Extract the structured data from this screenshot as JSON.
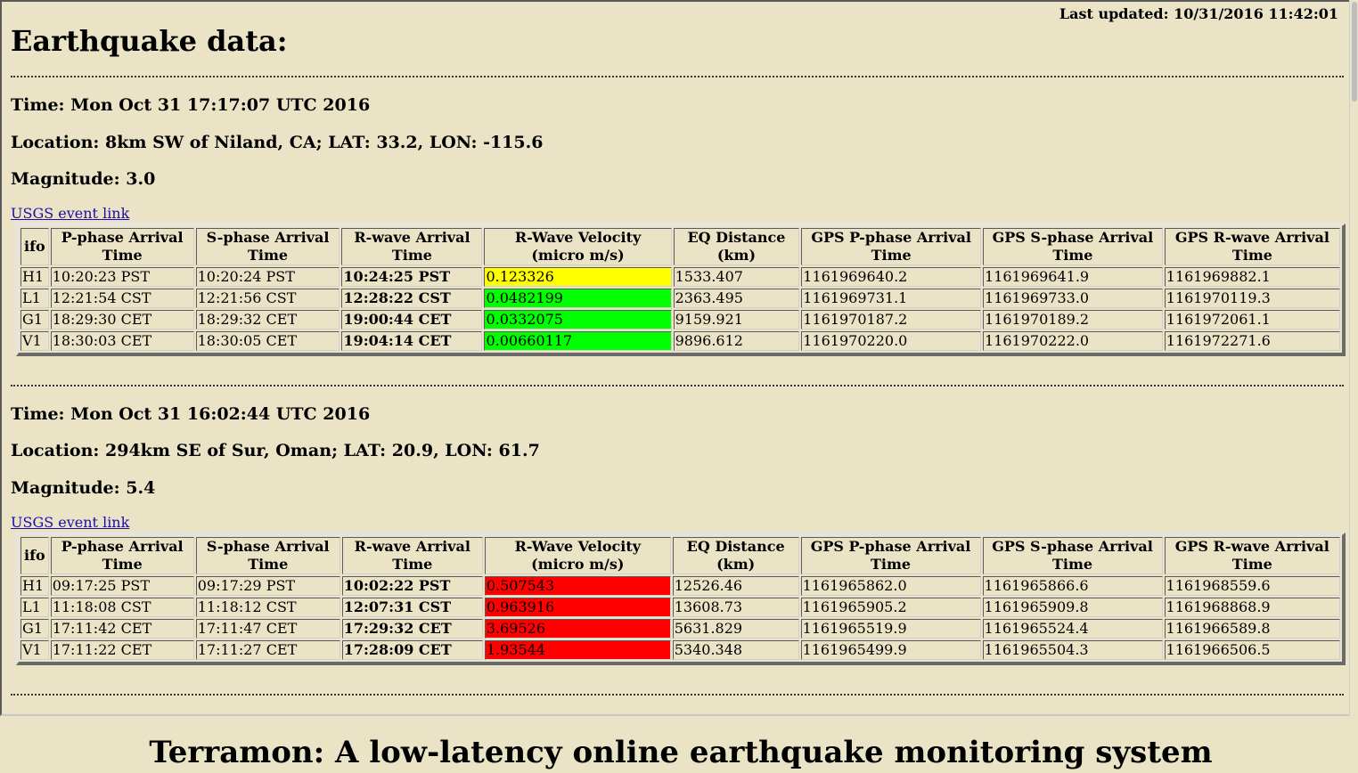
{
  "last_updated": "Last updated: 10/31/2016 11:42:01",
  "page_title": "Earthquake data:",
  "footer_title": "Terramon: A low-latency online earthquake monitoring system",
  "columns": [
    "ifo",
    "P-phase Arrival Time",
    "S-phase Arrival Time",
    "R-wave Arrival Time",
    "R-Wave Velocity (micro m/s)",
    "EQ Distance (km)",
    "GPS P-phase Arrival Time",
    "GPS S-phase Arrival Time",
    "GPS R-wave Arrival Time"
  ],
  "velocity_colors": {
    "yellow": "#ffff00",
    "green": "#00ff00",
    "red": "#ff0000"
  },
  "events": [
    {
      "time": "Time: Mon Oct 31 17:17:07 UTC 2016",
      "location": "Location: 8km SW of Niland, CA; LAT: 33.2, LON: -115.6",
      "magnitude": "Magnitude: 3.0",
      "link": "USGS event link",
      "rows": [
        {
          "ifo": "H1",
          "p": "10:20:23 PST",
          "s": "10:20:24 PST",
          "r": "10:24:25 PST",
          "v": "0.123326",
          "vcolor": "yellow",
          "dist": "1533.407",
          "gp": "1161969640.2",
          "gs": "1161969641.9",
          "gr": "1161969882.1"
        },
        {
          "ifo": "L1",
          "p": "12:21:54 CST",
          "s": "12:21:56 CST",
          "r": "12:28:22 CST",
          "v": "0.0482199",
          "vcolor": "green",
          "dist": "2363.495",
          "gp": "1161969731.1",
          "gs": "1161969733.0",
          "gr": "1161970119.3"
        },
        {
          "ifo": "G1",
          "p": "18:29:30 CET",
          "s": "18:29:32 CET",
          "r": "19:00:44 CET",
          "v": "0.0332075",
          "vcolor": "green",
          "dist": "9159.921",
          "gp": "1161970187.2",
          "gs": "1161970189.2",
          "gr": "1161972061.1"
        },
        {
          "ifo": "V1",
          "p": "18:30:03 CET",
          "s": "18:30:05 CET",
          "r": "19:04:14 CET",
          "v": "0.00660117",
          "vcolor": "green",
          "dist": "9896.612",
          "gp": "1161970220.0",
          "gs": "1161970222.0",
          "gr": "1161972271.6"
        }
      ]
    },
    {
      "time": "Time: Mon Oct 31 16:02:44 UTC 2016",
      "location": "Location: 294km SE of Sur, Oman; LAT: 20.9, LON: 61.7",
      "magnitude": "Magnitude: 5.4",
      "link": "USGS event link",
      "rows": [
        {
          "ifo": "H1",
          "p": "09:17:25 PST",
          "s": "09:17:29 PST",
          "r": "10:02:22 PST",
          "v": "0.507543",
          "vcolor": "red",
          "dist": "12526.46",
          "gp": "1161965862.0",
          "gs": "1161965866.6",
          "gr": "1161968559.6"
        },
        {
          "ifo": "L1",
          "p": "11:18:08 CST",
          "s": "11:18:12 CST",
          "r": "12:07:31 CST",
          "v": "0.963916",
          "vcolor": "red",
          "dist": "13608.73",
          "gp": "1161965905.2",
          "gs": "1161965909.8",
          "gr": "1161968868.9"
        },
        {
          "ifo": "G1",
          "p": "17:11:42 CET",
          "s": "17:11:47 CET",
          "r": "17:29:32 CET",
          "v": "3.69526",
          "vcolor": "red",
          "dist": "5631.829",
          "gp": "1161965519.9",
          "gs": "1161965524.4",
          "gr": "1161966589.8"
        },
        {
          "ifo": "V1",
          "p": "17:11:22 CET",
          "s": "17:11:27 CET",
          "r": "17:28:09 CET",
          "v": "1.93544",
          "vcolor": "red",
          "dist": "5340.348",
          "gp": "1161965499.9",
          "gs": "1161965504.3",
          "gr": "1161966506.5"
        }
      ]
    }
  ]
}
